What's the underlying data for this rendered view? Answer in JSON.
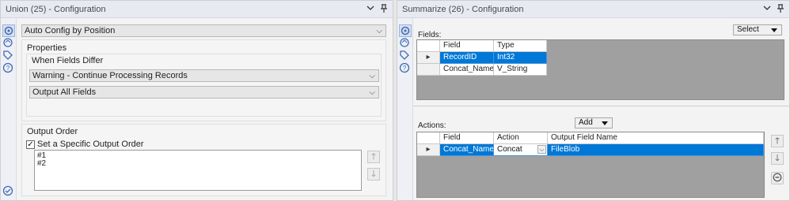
{
  "left": {
    "title": "Union (25) - Configuration",
    "auto_config": "Auto Config by Position",
    "properties_label": "Properties",
    "when_fields_differ_label": "When Fields Differ",
    "warning_select": "Warning - Continue Processing Records",
    "output_fields_select": "Output All Fields",
    "output_order_label": "Output Order",
    "set_specific_label": "Set a Specific Output Order",
    "set_specific_checked": true,
    "order_items": [
      "#1",
      "#2"
    ],
    "up_arrow": "🡑",
    "down_arrow": "🡓"
  },
  "right": {
    "title": "Summarize (26) - Configuration",
    "select_label": "Select",
    "fields_label": "Fields:",
    "fields_columns": [
      "Field",
      "Type"
    ],
    "fields_rows": [
      {
        "field": "RecordID",
        "type": "Int32",
        "selected": true
      },
      {
        "field": "Concat_Name",
        "type": "V_String",
        "selected": false
      }
    ],
    "add_label": "Add",
    "actions_label": "Actions:",
    "actions_columns": [
      "Field",
      "Action",
      "Output Field Name"
    ],
    "actions_rows": [
      {
        "field": "Concat_Name",
        "action": "Concat",
        "output": "FileBlob",
        "selected": true
      }
    ]
  },
  "icons": {
    "collapse": "⌄",
    "pin": "📌",
    "row_pointer": "▸",
    "check_mark": "✓"
  },
  "colors": {
    "selection": "#0078d7",
    "accent_icon": "#3d6bb5"
  }
}
